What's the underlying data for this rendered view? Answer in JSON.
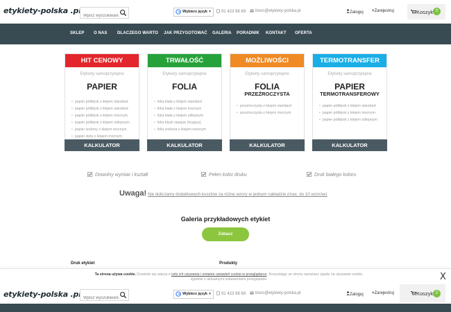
{
  "header": {
    "logo_main": "etykiety-polska",
    "logo_tld": " .pl",
    "search_placeholder": "Wpisz wyszukiwaną frazę",
    "lang_label": "Wybierz język",
    "phone": "91 423 98 69",
    "email": "biuro@etykiety-polska.pl",
    "login": "Zaloguj",
    "register": "Zarejestruj",
    "cart_label": "Koszyk",
    "cart_count": "0"
  },
  "nav": {
    "items": [
      "SKLEP",
      "O NAS",
      "DLACZEGO WARTO",
      "JAK PRZYGOTOWAĆ",
      "GALERIA",
      "PORADNIK",
      "KONTAKT",
      "OFERTA"
    ]
  },
  "cards": [
    {
      "head": "HIT CENOWY",
      "color": "#e3262b",
      "sub": "Etykiety samoprzylepne",
      "title": "PAPIER",
      "title2": "",
      "items": [
        "papier półbłysk z klejem standard",
        "papier półbłysk z klejem standard",
        "papier półbłysk z klejem mocnym",
        "papier półbłysk z klejem odlepnym",
        "papier srebrny z klejem mocnym",
        "papier złoty z klejem mocnym"
      ],
      "calc": "KALKULATOR"
    },
    {
      "head": "TRWAŁOŚĆ",
      "color": "#27a23b",
      "sub": "Etykiety samoprzylepne",
      "title": "FOLIA",
      "title2": "",
      "items": [
        "folia biała z klejem standard",
        "folia biała z klejem mocnym",
        "folia biała z klejem odlepnym",
        "folia błysk opaque (kryjąca)",
        "folia srebrna z klejem mocnym"
      ],
      "calc": "KALKULATOR"
    },
    {
      "head": "MOŻLIWOŚCI",
      "color": "#f08a24",
      "sub": "Etykiety samoprzylepne",
      "title": "FOLIA",
      "title2": "PRZEŹROCZYSTA",
      "items": [
        "przeźroczysta z klejem standard",
        "przeźroczysta z klejem mocnym"
      ],
      "calc": "KALKULATOR"
    },
    {
      "head": "TERMOTRANSFER",
      "color": "#19aee6",
      "sub": "Etykiety samoprzylepne",
      "title": "PAPIER",
      "title2": "TERMOTRANSFEROWY",
      "items": [
        "papier półbłysk z klejem standard",
        "papier półbłysk z klejem mocnym",
        "papier półbłysk z klejem odlepnym"
      ],
      "calc": "KALKULATOR"
    }
  ],
  "features": [
    "Dowolny wymiar i kształt",
    "Pełen kolor druku",
    "Druk białego koloru"
  ],
  "notice": {
    "bold": "Uwaga!",
    "text": "Nie doliczamy dodatkowych kosztów za różne wzory w jednym nakładzie (max. do 10 wzorów)"
  },
  "gallery": {
    "title": "Galeria przykładowych etykiet",
    "button": "Zobacz"
  },
  "footer": {
    "col1": "Druk etykiet",
    "col2": "Produkty"
  },
  "cookie": {
    "bold": "Ta strona używa cookie.",
    "text1": " Dowiedz się więcej o ",
    "link": "celu ich używania i zmianie ustawień cookie w przeglądarce",
    "text2": ". Korzystając ze strony wyrażasz zgodę na używanie cookie, zgodnie z aktualnymi ustawieniami przeglądarki.",
    "close": "X"
  },
  "colors": {
    "nav_bg": "#384a52",
    "accent_green": "#8cc63f",
    "calc_bg": "#4a5a63"
  }
}
